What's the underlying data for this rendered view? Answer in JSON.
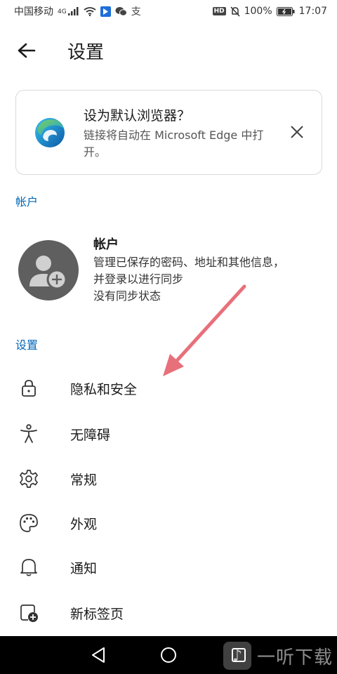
{
  "status_bar": {
    "carrier": "中国移动",
    "network": "4G",
    "battery": "100%",
    "time": "17:07",
    "hd_badge": "HD"
  },
  "header": {
    "title": "设置"
  },
  "banner": {
    "title": "设为默认浏览器？",
    "description": "链接将自动在 Microsoft Edge 中打开。"
  },
  "account_section": {
    "label": "帐户",
    "title": "帐户",
    "description_line1": "管理已保存的密码、地址和其他信息，",
    "description_line2": "并登录以进行同步",
    "sync_status": "没有同步状态"
  },
  "settings_section": {
    "label": "设置",
    "items": [
      {
        "label": "隐私和安全",
        "icon": "lock-icon"
      },
      {
        "label": "无障碍",
        "icon": "accessibility-icon"
      },
      {
        "label": "常规",
        "icon": "gear-icon"
      },
      {
        "label": "外观",
        "icon": "palette-icon"
      },
      {
        "label": "通知",
        "icon": "bell-icon"
      },
      {
        "label": "新标签页",
        "icon": "new-tab-icon"
      }
    ]
  },
  "watermark": {
    "text": "一听下载"
  },
  "colors": {
    "accent": "#0067b8",
    "arrow": "#e8707a",
    "avatar_bg": "#5f5f5f"
  }
}
